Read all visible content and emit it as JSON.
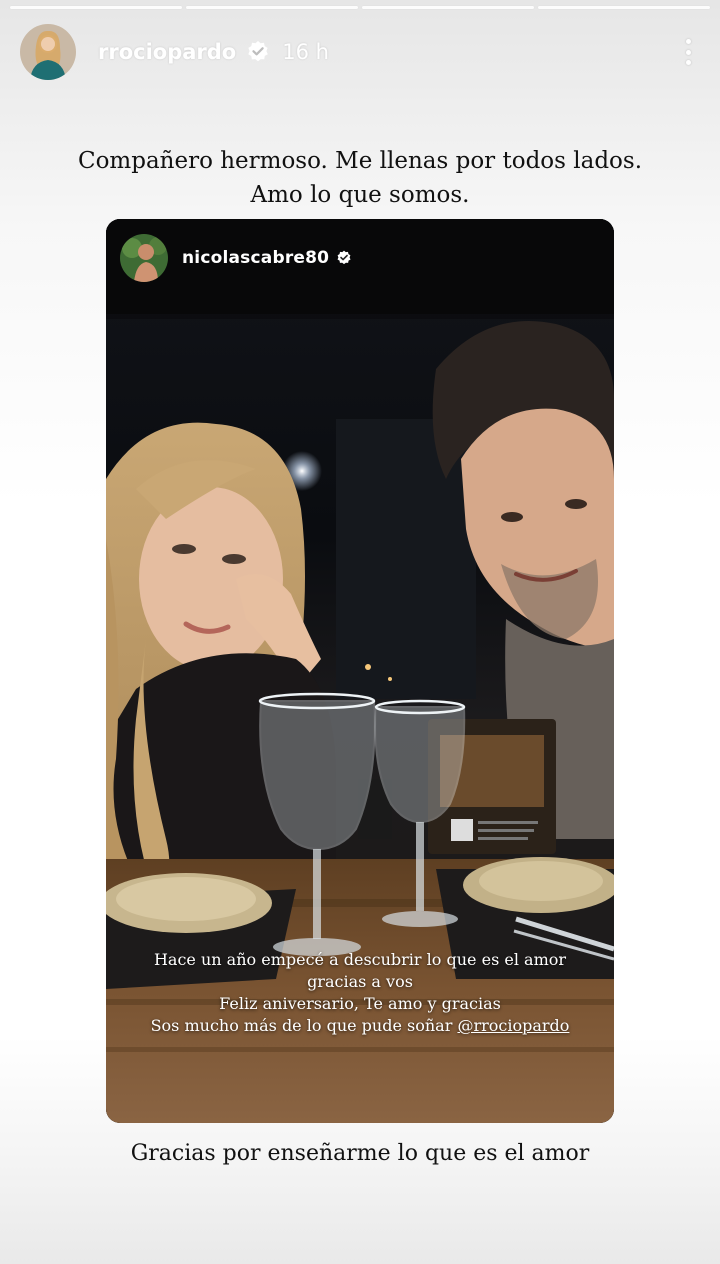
{
  "story": {
    "segments": 4,
    "username": "rrociopardo",
    "time": "16 h",
    "icons": {
      "verified": "verified-badge-icon",
      "more": "more-vertical-icon"
    }
  },
  "caption_top": {
    "line1": "Compañero hermoso. Me llenas por todos lados.",
    "line2": "Amo lo que somos."
  },
  "shared_story": {
    "username": "nicolascabre80",
    "caption": {
      "line1": "Hace un año empecé a descubrir lo que es el amor",
      "line2": "gracias a vos",
      "line3": "Feliz aniversario, Te amo y gracias",
      "line4_text": "Sos mucho más de lo que pude soñar",
      "line4_mention": "@rrociopardo"
    }
  },
  "caption_bottom": "Gracias por enseñarme lo que es el amor"
}
